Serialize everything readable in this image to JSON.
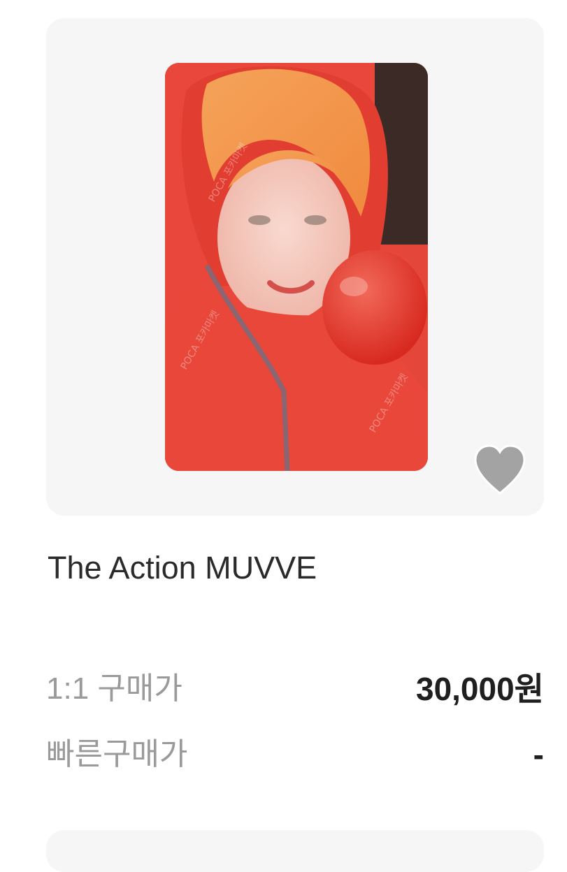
{
  "product": {
    "title": "The Action MUVVE",
    "image": {
      "description_icon": "photocard-image",
      "watermark": "POCA 포카마켓"
    },
    "favorite_icon": "heart-icon",
    "favorite_color": "#a3a3a3"
  },
  "pricing": {
    "one_to_one_label": "1:1 구매가",
    "one_to_one_value": "30,000원",
    "quick_buy_label": "빠른구매가",
    "quick_buy_value": "-"
  },
  "colors": {
    "card_background": "#f6f6f6",
    "label_gray": "#9a9a9a",
    "price_dark": "#1f1f1f"
  }
}
